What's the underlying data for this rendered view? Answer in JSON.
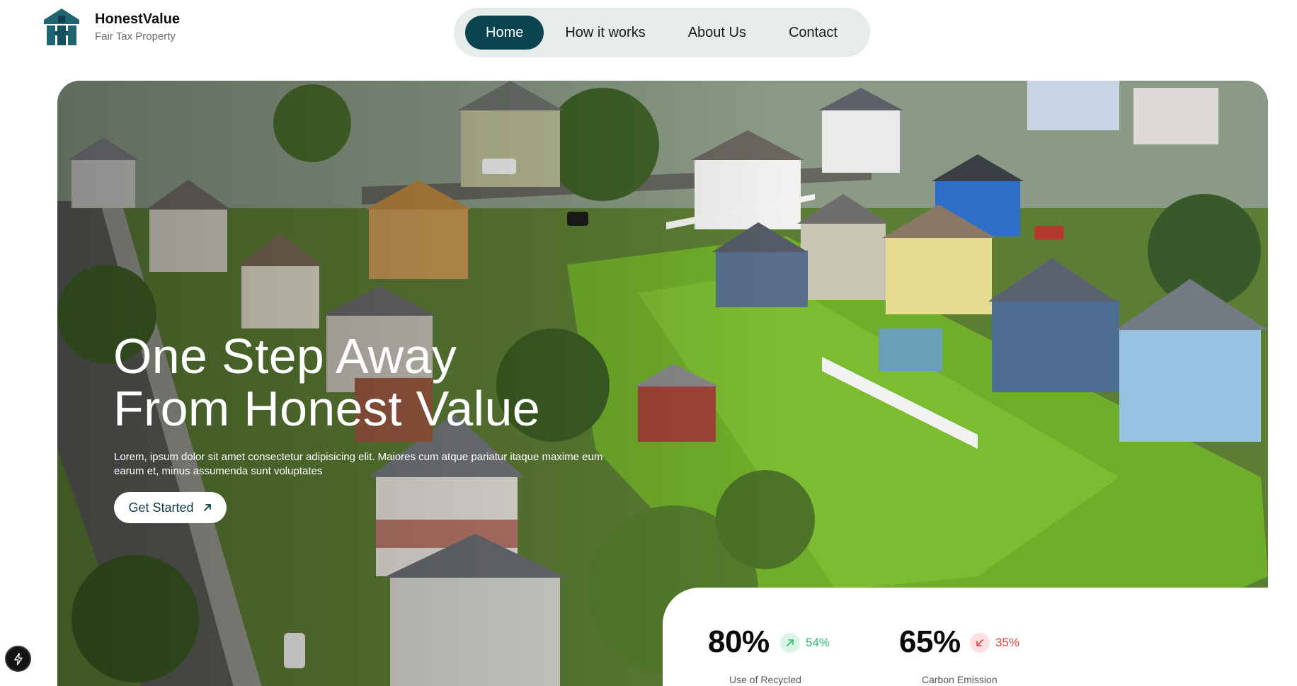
{
  "brand": {
    "name": "HonestValue",
    "tagline": "Fair Tax Property"
  },
  "nav": {
    "items": [
      {
        "label": "Home",
        "active": true
      },
      {
        "label": "How it works",
        "active": false
      },
      {
        "label": "About Us",
        "active": false
      },
      {
        "label": "Contact",
        "active": false
      }
    ]
  },
  "hero": {
    "title_line1": "One Step Away",
    "title_line2": "From Honest Value",
    "description": "Lorem, ipsum dolor sit amet consectetur adipisicing elit. Maiores cum atque pariatur itaque maxime eum earum et, minus assumenda sunt voluptates",
    "cta_label": "Get Started",
    "cta_icon": "arrow-up-right-icon",
    "image": "aerial-suburban-neighborhood-photo"
  },
  "stats": [
    {
      "value": "80%",
      "change": "54%",
      "trend": "up",
      "trend_icon": "arrow-up-right-icon",
      "label": "Use of Recycled"
    },
    {
      "value": "65%",
      "change": "35%",
      "trend": "down",
      "trend_icon": "arrow-down-left-icon",
      "label": "Carbon Emission"
    }
  ],
  "colors": {
    "accent": "#0b4650",
    "nav_bg": "#e6ecea",
    "positive": "#2fbb6b",
    "negative": "#e2413b"
  },
  "floating_button": {
    "icon": "lightning-bolt-icon"
  }
}
